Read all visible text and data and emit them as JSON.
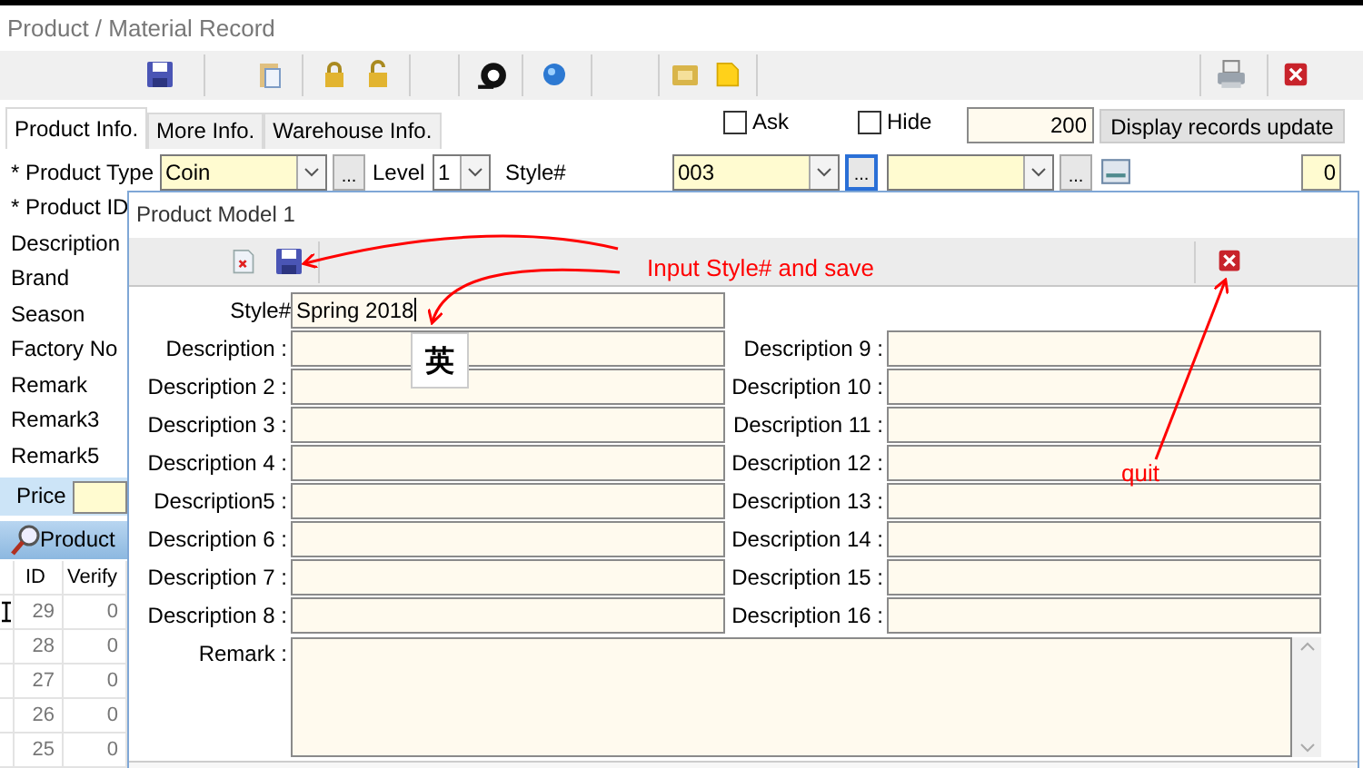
{
  "window": {
    "title": "Product / Material Record"
  },
  "tabs": [
    {
      "label": "Product Info.",
      "selected": true
    },
    {
      "label": "More Info.",
      "selected": false
    },
    {
      "label": "Warehouse Info.",
      "selected": false
    }
  ],
  "options": [
    {
      "label": "Ask",
      "checked": false
    },
    {
      "label": "Hide",
      "checked": false
    }
  ],
  "record_count": "200",
  "display_button": "Display records update",
  "product_type": {
    "label": "* Product Type",
    "value": "Coin",
    "level_label": "Level",
    "level_value": "1",
    "style_label": "Style#",
    "style_value": "003",
    "count": "0"
  },
  "ellipsis_buttons": [
    "...",
    "...",
    "..."
  ],
  "left_labels": [
    "* Product ID",
    "Description",
    "Brand",
    "Season",
    "Factory No",
    "Remark",
    "Remark3",
    "Remark5"
  ],
  "price_label": "Price",
  "product_panel": {
    "title": "Product"
  },
  "table": {
    "columns": [
      "ID",
      "Verify"
    ],
    "rows": [
      {
        "id": "29",
        "verify": "0",
        "current": true
      },
      {
        "id": "28",
        "verify": "0",
        "current": false
      },
      {
        "id": "27",
        "verify": "0",
        "current": false
      },
      {
        "id": "26",
        "verify": "0",
        "current": false
      },
      {
        "id": "25",
        "verify": "0",
        "current": false
      }
    ]
  },
  "dialog": {
    "title": "Product Model 1",
    "style": {
      "label": "Style#",
      "value": "Spring 2018"
    },
    "left_fields": [
      {
        "label": "Description :"
      },
      {
        "label": "Description 2 :"
      },
      {
        "label": "Description 3 :"
      },
      {
        "label": "Description 4 :"
      },
      {
        "label": "Description5 :"
      },
      {
        "label": "Description 6 :"
      },
      {
        "label": "Description 7 :"
      },
      {
        "label": "Description 8 :"
      }
    ],
    "right_fields": [
      {
        "label": "Description 9 :"
      },
      {
        "label": "Description 10 :"
      },
      {
        "label": "Description 11 :"
      },
      {
        "label": "Description 12 :"
      },
      {
        "label": "Description 13 :"
      },
      {
        "label": "Description 14 :"
      },
      {
        "label": "Description 15 :"
      },
      {
        "label": "Description 16 :"
      }
    ],
    "remark_label": "Remark :"
  },
  "ime_indicator": "英",
  "annotations": [
    {
      "text": "Input Style# and save"
    },
    {
      "text": "quit"
    }
  ]
}
